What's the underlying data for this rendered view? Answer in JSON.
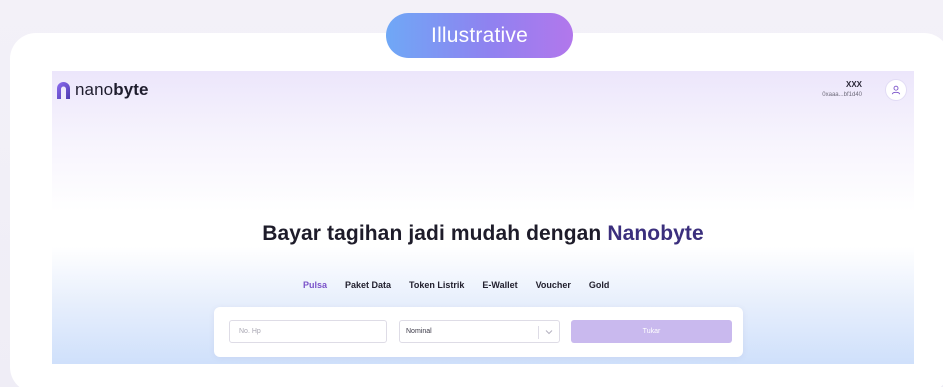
{
  "badge": {
    "label": "Illustrative"
  },
  "header": {
    "logo": {
      "prefix": "nano",
      "suffix": "byte"
    },
    "user": {
      "name": "XXX",
      "address": "0xaaa...bf1d40"
    },
    "icons": {
      "logo": "nanobyte-logo-icon",
      "avatar": "user-icon"
    }
  },
  "hero": {
    "headline_prefix": "Bayar tagihan jadi mudah dengan ",
    "headline_brand": "Nanobyte"
  },
  "tabs": [
    {
      "label": "Pulsa",
      "active": true
    },
    {
      "label": "Paket Data",
      "active": false
    },
    {
      "label": "Token Listrik",
      "active": false
    },
    {
      "label": "E-Wallet",
      "active": false
    },
    {
      "label": "Voucher",
      "active": false
    },
    {
      "label": "Gold",
      "active": false
    }
  ],
  "form": {
    "phone_placeholder": "No. Hp",
    "phone_value": "",
    "nominal_label": "Nominal",
    "submit_label": "Tukar"
  },
  "colors": {
    "accent": "#7a52c9",
    "brand": "#3b2f7d",
    "button": "#c9b9ee",
    "badge_start": "#6fa8f6",
    "badge_end": "#b277ec"
  }
}
